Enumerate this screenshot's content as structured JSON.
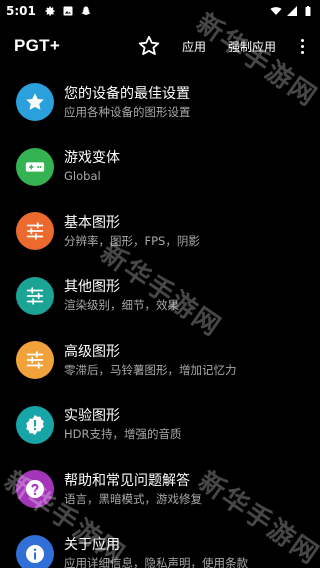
{
  "status_bar": {
    "time": "5:01",
    "icons": [
      "gear-icon",
      "image-icon",
      "snapchat-ghost-icon",
      "wifi-icon",
      "signal-icon",
      "battery-icon"
    ]
  },
  "app_bar": {
    "title": "PGT+",
    "apply_label": "应用",
    "force_apply_label": "强制应用",
    "icons": [
      "star-outline-icon",
      "more-vert-icon"
    ]
  },
  "menu": {
    "items": [
      {
        "title": "您的设备的最佳设置",
        "subtitle": "应用各种设备的图形设置",
        "icon": "star-icon",
        "color": "#2AA0DC"
      },
      {
        "title": "游戏变体",
        "subtitle": "Global",
        "icon": "gamepad-icon",
        "color": "#35B251"
      },
      {
        "title": "基本图形",
        "subtitle": "分辨率，图形，FPS，阴影",
        "icon": "sliders-icon",
        "color": "#EC6A2E"
      },
      {
        "title": "其他图形",
        "subtitle": "渲染级别，细节，效果",
        "icon": "sliders-icon",
        "color": "#1BA393"
      },
      {
        "title": "高级图形",
        "subtitle": "零滞后，马铃薯图形，增加记忆力",
        "icon": "sliders-icon",
        "color": "#F2A23A"
      },
      {
        "title": "实验图形",
        "subtitle": "HDR支持，增强的音质",
        "icon": "alert-badge-icon",
        "color": "#18A5A8"
      },
      {
        "title": "帮助和常见问题解答",
        "subtitle": "语言，黑暗模式，游戏修复",
        "icon": "help-icon",
        "color": "#A336B8"
      },
      {
        "title": "关于应用",
        "subtitle": "应用详细信息，隐私声明，使用条款",
        "icon": "info-icon",
        "color": "#2F6FD6"
      }
    ]
  },
  "watermark": "新华手游网"
}
